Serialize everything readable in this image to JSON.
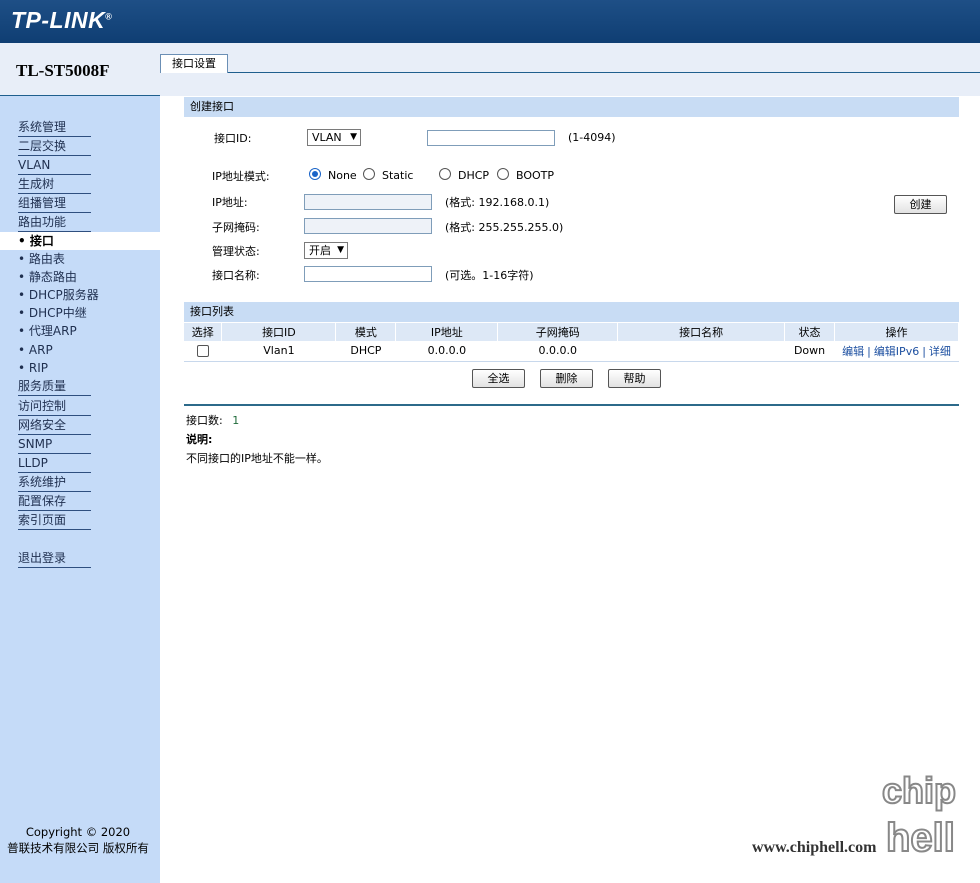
{
  "header": {
    "brand": "TP-LINK",
    "trademark": "®",
    "model": "TL-ST5008F"
  },
  "tabs": [
    {
      "label": "接口设置",
      "active": true
    }
  ],
  "sidebar": {
    "items": [
      {
        "label": "系统管理"
      },
      {
        "label": "二层交换"
      },
      {
        "label": "VLAN"
      },
      {
        "label": "生成树"
      },
      {
        "label": "组播管理"
      },
      {
        "label": "路由功能"
      }
    ],
    "sub_items": [
      {
        "label": "• 接口",
        "active": true
      },
      {
        "label": "• 路由表"
      },
      {
        "label": "• 静态路由"
      },
      {
        "label": "• DHCP服务器"
      },
      {
        "label": "• DHCP中继"
      },
      {
        "label": "• 代理ARP"
      },
      {
        "label": "• ARP"
      },
      {
        "label": "• RIP"
      }
    ],
    "items_after": [
      {
        "label": "服务质量"
      },
      {
        "label": "访问控制"
      },
      {
        "label": "网络安全"
      },
      {
        "label": "SNMP"
      },
      {
        "label": "LLDP"
      },
      {
        "label": "系统维护"
      },
      {
        "label": "配置保存"
      },
      {
        "label": "索引页面"
      }
    ],
    "logout": "退出登录",
    "copyright_line1": "Copyright © 2020",
    "copyright_line2": "普联技术有限公司 版权所有"
  },
  "create": {
    "section_title": "创建接口",
    "interface_id_label": "接口ID:",
    "interface_type": "VLAN",
    "interface_id_value": "",
    "interface_id_range": "(1-4094)",
    "ip_mode_label": "IP地址模式:",
    "ip_modes": [
      "None",
      "Static",
      "DHCP",
      "BOOTP"
    ],
    "ip_mode_selected": "None",
    "ip_label": "IP地址:",
    "ip_value": "",
    "ip_hint": "(格式:  192.168.0.1)",
    "mask_label": "子网掩码:",
    "mask_value": "",
    "mask_hint": "(格式:  255.255.255.0)",
    "admin_label": "管理状态:",
    "admin_value": "开启",
    "name_label": "接口名称:",
    "name_value": "",
    "name_hint": "(可选。1-16字符)",
    "create_button": "创建"
  },
  "list": {
    "section_title": "接口列表",
    "columns": [
      "选择",
      "接口ID",
      "模式",
      "IP地址",
      "子网掩码",
      "接口名称",
      "状态",
      "操作"
    ],
    "rows": [
      {
        "checked": false,
        "id": "Vlan1",
        "mode": "DHCP",
        "ip": "0.0.0.0",
        "mask": "0.0.0.0",
        "name": "",
        "status": "Down",
        "actions": [
          "编辑",
          "编辑IPv6",
          "详细"
        ]
      }
    ],
    "buttons": {
      "select_all": "全选",
      "delete": "删除",
      "help": "帮助"
    }
  },
  "footer": {
    "count_label": "接口数:",
    "count_value": "1",
    "note_title": "说明:",
    "note_text": "不同接口的IP地址不能一样。"
  },
  "watermark": {
    "url": "www.chiphell.com",
    "logo_line1": "chip",
    "logo_line2": "hell"
  },
  "colors": {
    "banner": "#134478",
    "sidebar": "#c5dbf8",
    "section": "#c8dcf4",
    "link": "#1c4fa0"
  }
}
